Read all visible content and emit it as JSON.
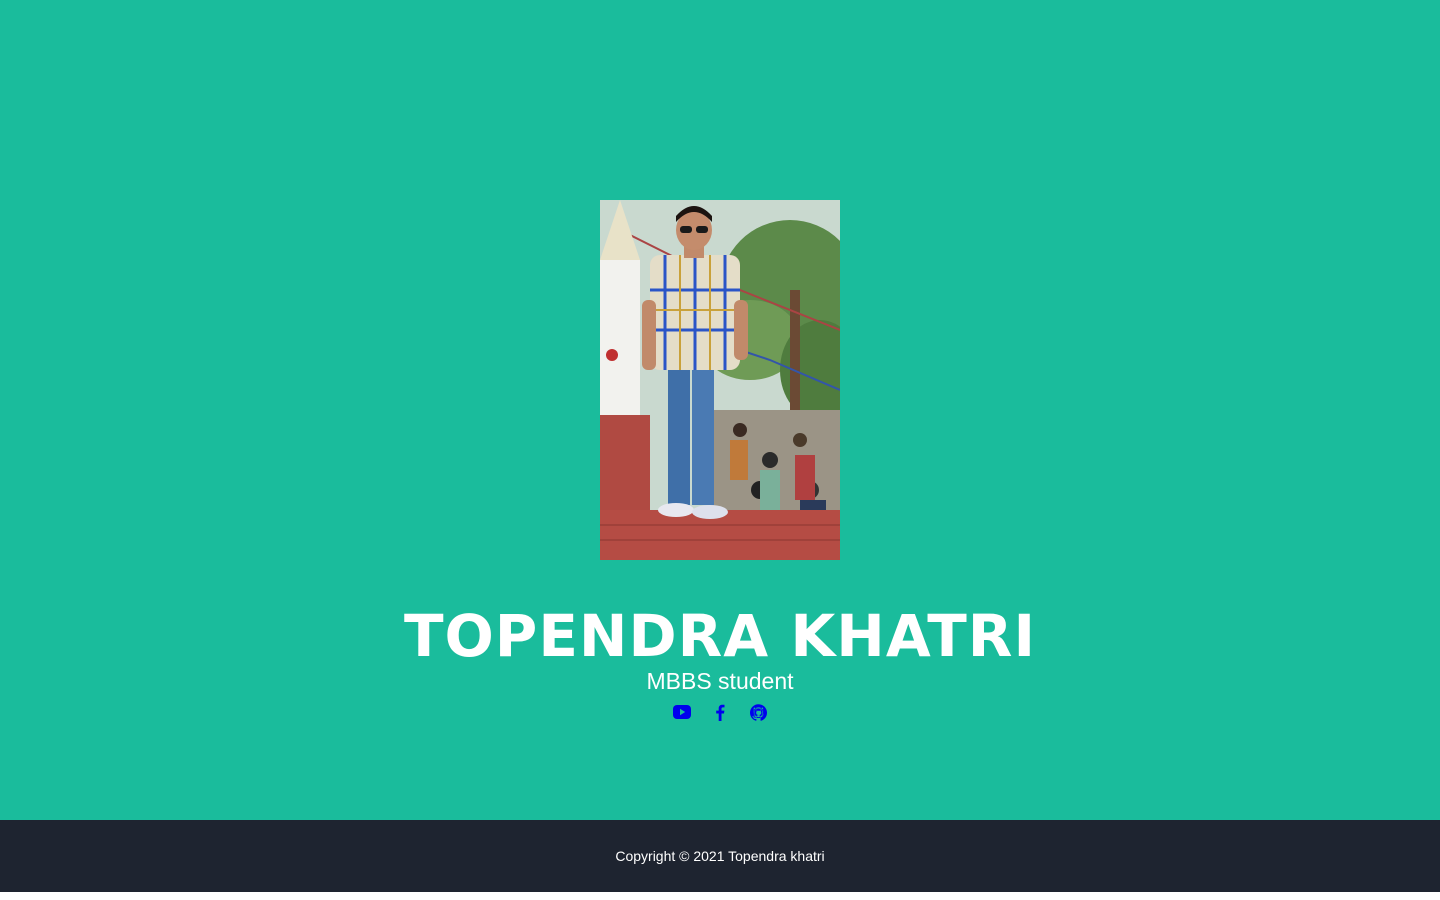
{
  "hero": {
    "name": "TOPENDRA KHATRI",
    "subtitle": "MBBS student"
  },
  "socials": [
    {
      "icon": "youtube-icon",
      "label": "YouTube"
    },
    {
      "icon": "facebook-icon",
      "label": "Facebook"
    },
    {
      "icon": "github-icon",
      "label": "GitHub"
    }
  ],
  "footer": {
    "copyright": "Copyright © 2021 Topendra khatri"
  },
  "colors": {
    "masthead_bg": "#1abc9c",
    "footer_bg": "#1e2430",
    "icon_color": "#0000ee",
    "text": "#ffffff"
  }
}
